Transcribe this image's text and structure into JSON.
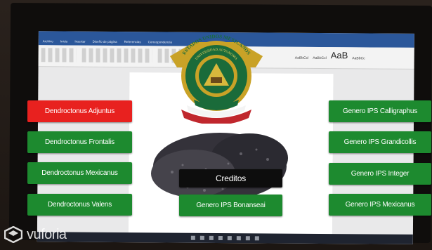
{
  "word_window": {
    "ribbon_tabs": [
      "Archivo",
      "Inicio",
      "Insertar",
      "Diseño de página",
      "Referencias",
      "Correspondencia"
    ],
    "style_samples": [
      "AaBbCcl",
      "AaBbCcl",
      "AaB",
      "AaBbCc"
    ]
  },
  "seal": {
    "top_text": "ESTADOS UNIDOS MEXICANOS",
    "inner_text": "UNIVERSIDAD AUTONOMA",
    "colors": {
      "gold": "#c9a227",
      "green": "#1a6b3a",
      "red": "#c0272d",
      "white": "#f4f4f4"
    }
  },
  "buttons_left": [
    {
      "label": "Dendroctonus Adjuntus",
      "color": "#e8211f"
    },
    {
      "label": "Dendroctonus Frontalis",
      "color": "#1d8a2f"
    },
    {
      "label": "Dendroctonus Mexicanus",
      "color": "#1d8a2f"
    },
    {
      "label": "Dendroctonus Valens",
      "color": "#1d8a2f"
    }
  ],
  "buttons_right": [
    {
      "label": "Genero IPS Calligraphus",
      "color": "#1d8a2f"
    },
    {
      "label": "Genero IPS Grandicollis",
      "color": "#1d8a2f"
    },
    {
      "label": "Genero IPS Integer",
      "color": "#1d8a2f"
    },
    {
      "label": "Genero IPS Mexicanus",
      "color": "#1d8a2f"
    }
  ],
  "buttons_center": {
    "creditos": "Creditos",
    "bonanseai": "Genero IPS Bonanseai"
  },
  "watermark": {
    "text": "vuforia",
    "icon": "vuforia-logo-icon"
  }
}
